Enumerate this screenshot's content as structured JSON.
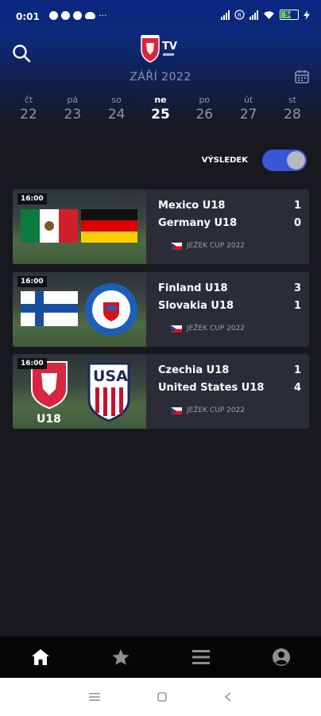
{
  "status_bar": {
    "time": "0:01",
    "battery": "56"
  },
  "header": {
    "logo_icon": "facr-tv-logo",
    "logo_text": "TV",
    "month": "ZÁŘÍ 2022"
  },
  "days": [
    {
      "name": "čt",
      "date": "22",
      "active": false
    },
    {
      "name": "pá",
      "date": "23",
      "active": false
    },
    {
      "name": "so",
      "date": "24",
      "active": false
    },
    {
      "name": "ne",
      "date": "25",
      "active": true
    },
    {
      "name": "po",
      "date": "26",
      "active": false
    },
    {
      "name": "út",
      "date": "27",
      "active": false
    },
    {
      "name": "st",
      "date": "28",
      "active": false
    }
  ],
  "results_toggle": {
    "label": "VÝSLEDEK",
    "on": true
  },
  "matches": [
    {
      "time": "16:00",
      "home": "Mexico U18",
      "away": "Germany U18",
      "home_score": "1",
      "away_score": "0",
      "competition": "JEŽEK CUP 2022"
    },
    {
      "time": "16:00",
      "home": "Finland U18",
      "away": "Slovakia U18",
      "home_score": "3",
      "away_score": "1",
      "competition": "JEŽEK CUP 2022"
    },
    {
      "time": "16:00",
      "home": "Czechia U18",
      "away": "United States U18",
      "home_score": "1",
      "away_score": "4",
      "competition": "JEŽEK CUP 2022"
    }
  ],
  "thumb_extra": {
    "czech_label": "U18",
    "usa_text": "USA"
  },
  "colors": {
    "accent": "#3957d6",
    "card": "#2a2d36",
    "background": "#17191f",
    "header_top": "#0a2680"
  },
  "bottom_nav": [
    "home-icon",
    "star-icon",
    "menu-icon",
    "account-icon"
  ]
}
